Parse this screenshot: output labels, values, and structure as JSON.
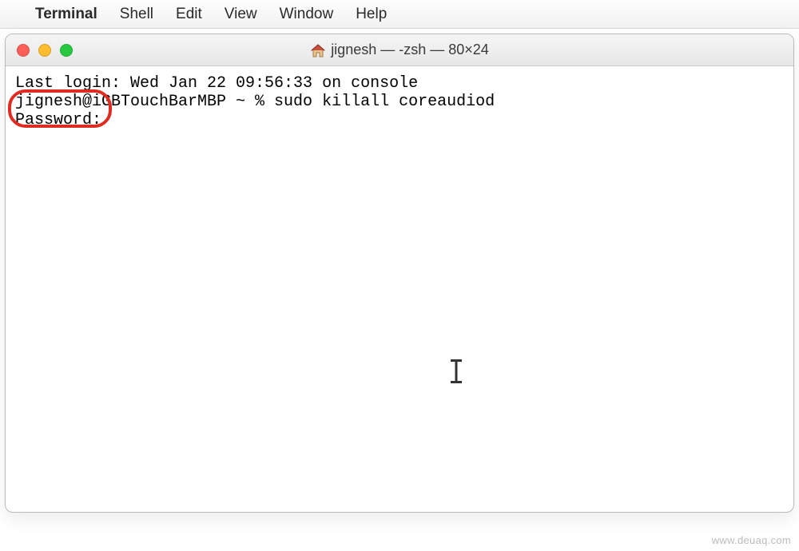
{
  "menubar": {
    "appname": "Terminal",
    "items": [
      "Shell",
      "Edit",
      "View",
      "Window",
      "Help"
    ]
  },
  "window": {
    "title": "jignesh — -zsh — 80×24"
  },
  "terminal": {
    "lines": [
      "Last login: Wed Jan 22 09:56:33 on console",
      "jignesh@iGBTouchBarMBP ~ % sudo killall coreaudiod",
      "Password:"
    ]
  },
  "watermark": "www.deuaq.com"
}
